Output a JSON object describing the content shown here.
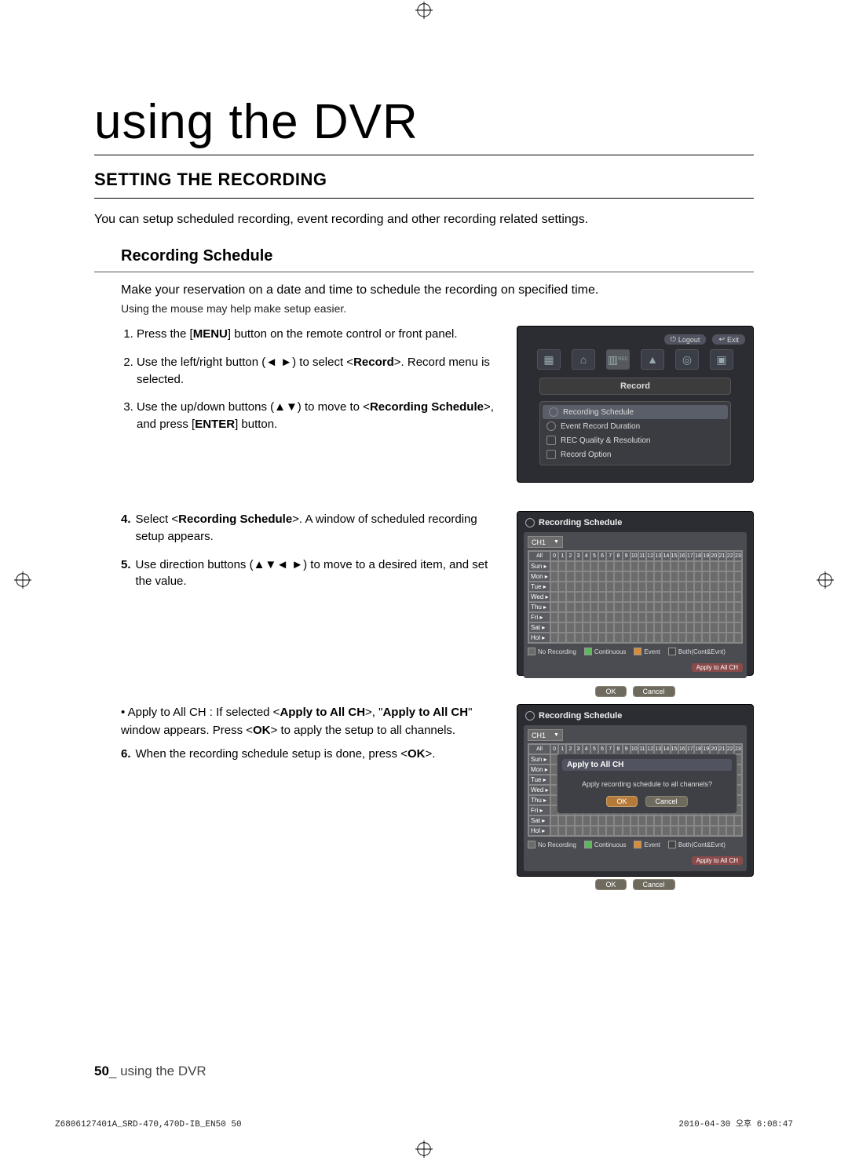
{
  "page": {
    "title": "using the DVR",
    "section": "SETTING THE RECORDING",
    "intro": "You can setup scheduled recording, event recording and other recording related settings.",
    "subsection": "Recording Schedule",
    "lead": "Make your reservation on a date and time to schedule the recording on specified time.",
    "hint": "Using the mouse may help make setup easier.",
    "footer_page": "50",
    "footer_label": "_ using the DVR",
    "meta_left": "Z6806127401A_SRD-470,470D-IB_EN50   50",
    "meta_right": "2010-04-30   오후 6:08:47"
  },
  "steps_a": [
    {
      "pre": "Press the [",
      "bold": "MENU",
      "post": "] button on the remote control or front panel."
    },
    {
      "pre": "Use the left/right button (◄ ►) to select <",
      "bold": "Record",
      "post": ">. Record menu is selected."
    },
    {
      "pre": "Use the up/down buttons (▲▼) to move to <",
      "bold": "Recording Schedule",
      "post": ">, and press [",
      "bold2": "ENTER",
      "post2": "] button."
    }
  ],
  "steps_b": [
    {
      "n": "4.",
      "pre": "Select <",
      "bold": "Recording Schedule",
      "post": ">. A window of scheduled recording setup appears."
    },
    {
      "n": "5.",
      "pre": "Use direction buttons (▲▼◄ ►) to move to a desired item, and set the value.",
      "bold": "",
      "post": ""
    }
  ],
  "bullet_c": {
    "pre": "Apply to All CH : If selected <",
    "bold1": "Apply to All CH",
    "mid": ">, \"",
    "bold2": "Apply to All CH",
    "post": "\" window appears. Press <",
    "bold3": "OK",
    "end": "> to apply the setup to all channels."
  },
  "steps_c": [
    {
      "n": "6.",
      "pre": "When the recording schedule setup is done, press <",
      "bold": "OK",
      "post": ">."
    }
  ],
  "fig1": {
    "logout": "Logout",
    "exit": "Exit",
    "title": "Record",
    "menu": [
      "Recording Schedule",
      "Event Record Duration",
      "REC Quality & Resolution",
      "Record Option"
    ]
  },
  "fig2": {
    "title": "Recording Schedule",
    "channel": "CH1",
    "all": "All",
    "hours": [
      "0",
      "1",
      "2",
      "3",
      "4",
      "5",
      "6",
      "7",
      "8",
      "9",
      "10",
      "11",
      "12",
      "13",
      "14",
      "15",
      "16",
      "17",
      "18",
      "19",
      "20",
      "21",
      "22",
      "23"
    ],
    "days": [
      "Sun",
      "Mon",
      "Tue",
      "Wed",
      "Thu",
      "Fri",
      "Sat",
      "Hol"
    ],
    "legend": {
      "no": "No Recording",
      "cont": "Continuous",
      "event": "Event",
      "both": "Both(Cont&Evnt)"
    },
    "apply": "Apply to All CH",
    "ok": "OK",
    "cancel": "Cancel"
  },
  "fig3": {
    "title": "Recording Schedule",
    "channel": "CH1",
    "modal_title": "Apply to All CH",
    "modal_text": "Apply recording schedule to all channels?",
    "ok": "OK",
    "cancel": "Cancel",
    "all": "All",
    "days": [
      "Sun",
      "Mon",
      "Tue",
      "Wed",
      "Thu",
      "Fri",
      "Sat",
      "Hol"
    ],
    "legend": {
      "no": "No Recording",
      "cont": "Continuous",
      "event": "Event",
      "both": "Both(Cont&Evnt)"
    },
    "apply": "Apply to All CH"
  }
}
